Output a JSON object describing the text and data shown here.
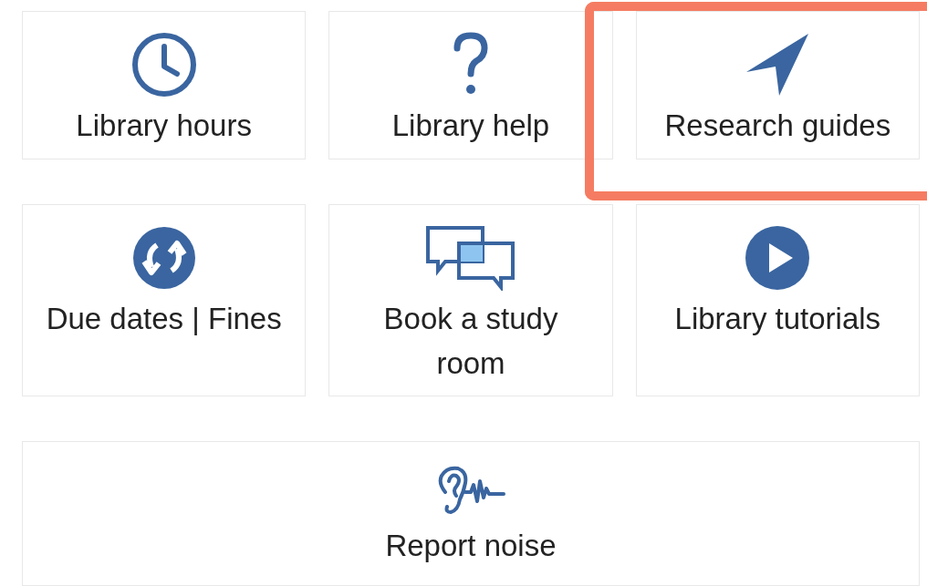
{
  "tiles": [
    {
      "label": "Library hours",
      "highlighted": false
    },
    {
      "label": "Library help",
      "highlighted": false
    },
    {
      "label": "Research guides",
      "highlighted": true
    },
    {
      "label": "Due dates | Fines",
      "highlighted": false
    },
    {
      "label": "Book a study room",
      "highlighted": false
    },
    {
      "label": "Library tutorials",
      "highlighted": false
    },
    {
      "label": "Report noise",
      "highlighted": false
    }
  ]
}
